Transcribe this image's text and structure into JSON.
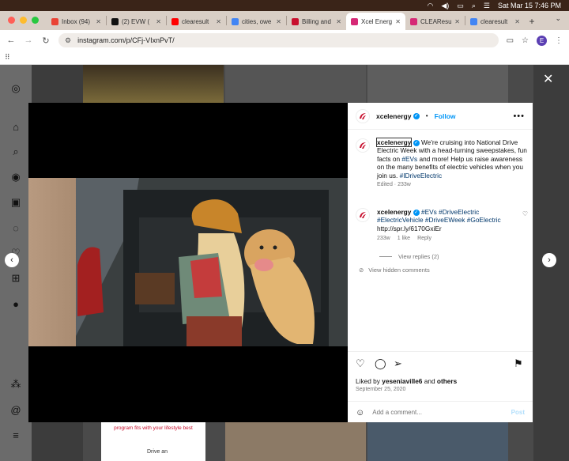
{
  "menubar": {
    "datetime": "Sat Mar 15  7:46 PM"
  },
  "tabs": [
    {
      "label": "Inbox (94)",
      "color": "#ea4335"
    },
    {
      "label": "(2) EVW (",
      "color": "#111111"
    },
    {
      "label": "clearesult",
      "color": "#ff0000"
    },
    {
      "label": "cities, owe",
      "color": "#4285f4"
    },
    {
      "label": "Billing and",
      "color": "#c8102e"
    },
    {
      "label": "Xcel Energ",
      "color": "#d62976"
    },
    {
      "label": "CLEAResul",
      "color": "#d62976"
    },
    {
      "label": "clearesult",
      "color": "#4285f4"
    }
  ],
  "address": {
    "url": "instagram.com/p/CFj-VIxnPvT/",
    "profile_initial": "E"
  },
  "post": {
    "username": "xcelenergy",
    "follow_label": "Follow",
    "caption": "We're cruising into National Drive Electric Week with a head-turning sweepstakes, fun facts on",
    "caption_tag1": "#EVs",
    "caption_mid": "and more! Help us raise awareness on the many benefits of electric vehicles when you join us.",
    "caption_tag2": "#IDriveElectric",
    "caption_meta": "Edited · 233w",
    "comment_user": "xcelenergy",
    "comment_tags": "#EVs #DriveElectric #ElectricVehicle #DriveEWeek #GoElectric",
    "comment_link": "http://spr.ly/6170GxiEr",
    "comment_age": "233w",
    "comment_likes": "1 like",
    "comment_reply": "Reply",
    "view_replies": "View replies (2)",
    "hidden_comments": "View hidden comments",
    "liked_prefix": "Liked by",
    "liked_user": "yeseniaville6",
    "liked_suffix": "and",
    "liked_others": "others",
    "date": "September 25, 2020",
    "add_comment_placeholder": "Add a comment...",
    "post_label": "Post"
  },
  "feed": {
    "promo_text": "program fits with your lifestyle best",
    "drive_text": "Drive an"
  },
  "colors": {
    "ig_blue": "#0095f6",
    "xcel_red": "#c8102e"
  }
}
